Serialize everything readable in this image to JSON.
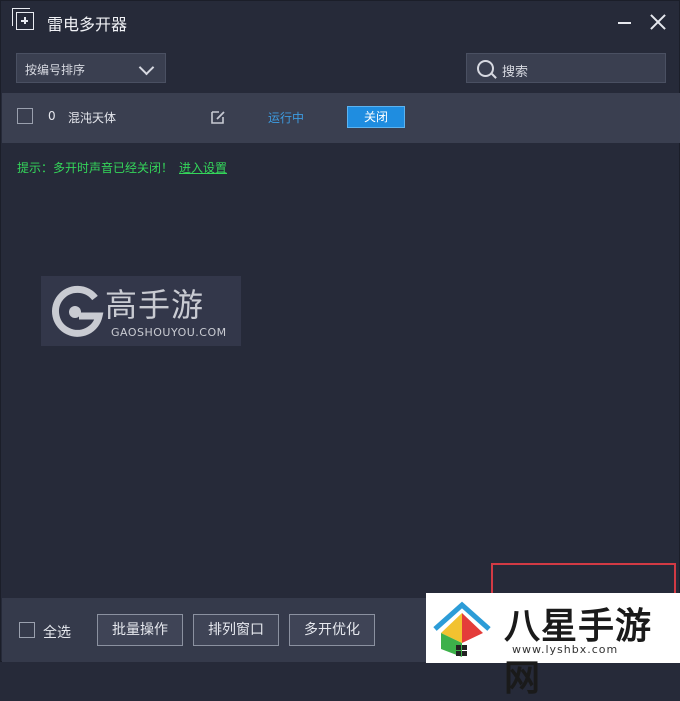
{
  "window": {
    "title": "雷电多开器"
  },
  "toolbar": {
    "sort_label": "按编号排序",
    "search_placeholder": "搜索"
  },
  "instances": [
    {
      "index": "0",
      "name": "混沌天体",
      "status": "运行中",
      "action_label": "关闭"
    }
  ],
  "hint": {
    "text": "提示：多开时声音已经关闭！",
    "link": "进入设置"
  },
  "watermark": {
    "title": "高手游",
    "url": "GAOSHOUYOU.COM"
  },
  "bottom": {
    "select_all": "全选",
    "buttons": [
      "批量操作",
      "排列窗口",
      "多开优化"
    ]
  },
  "corner_logo": {
    "title": "八星手游网",
    "url": "www.lyshbx.com"
  },
  "colors": {
    "background": "#262a39",
    "row": "#3a3f50",
    "accent": "#1f8de0",
    "hint": "#34d65a",
    "highlight": "#d23a44"
  }
}
